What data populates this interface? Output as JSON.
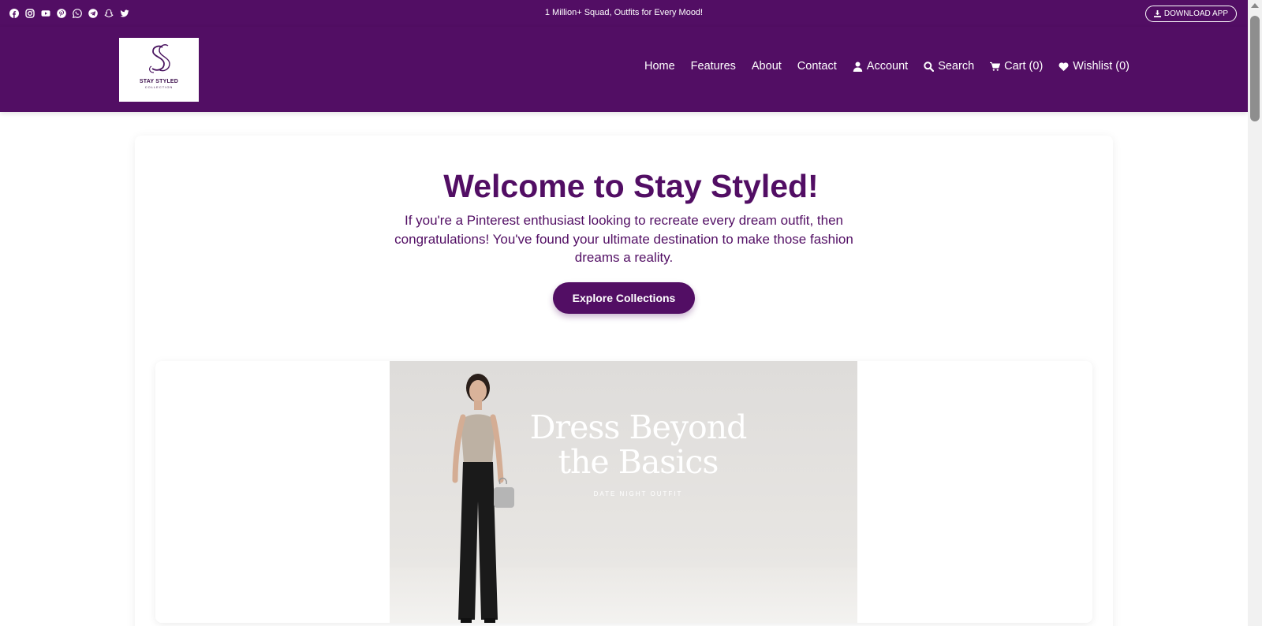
{
  "topbar": {
    "socials": [
      {
        "name": "facebook-icon"
      },
      {
        "name": "instagram-icon"
      },
      {
        "name": "youtube-icon"
      },
      {
        "name": "pinterest-icon"
      },
      {
        "name": "whatsapp-icon"
      },
      {
        "name": "telegram-icon"
      },
      {
        "name": "snapchat-icon"
      },
      {
        "name": "twitter-icon"
      }
    ],
    "announcement": "1 Million+ Squad, Outfits for Every Mood!",
    "download_label": "DOWNLOAD APP"
  },
  "logo": {
    "name": "STAY STYLED",
    "sub": "COLLECTION"
  },
  "nav": {
    "home": "Home",
    "features": "Features",
    "about": "About",
    "contact": "Contact",
    "account": "Account",
    "search": "Search",
    "cart": "Cart (0)",
    "wishlist": "Wishlist (0)"
  },
  "hero": {
    "title": "Welcome to Stay Styled!",
    "text": "If you're a Pinterest enthusiast looking to recreate every dream outfit, then congratulations! You've found your ultimate destination to make those fashion dreams a reality.",
    "cta": "Explore Collections"
  },
  "banner": {
    "headline_line1": "Dress Beyond",
    "headline_line2": "the Basics",
    "subline": "DATE NIGHT OUTFIT"
  },
  "colors": {
    "brand": "#520e64",
    "white": "#ffffff"
  }
}
